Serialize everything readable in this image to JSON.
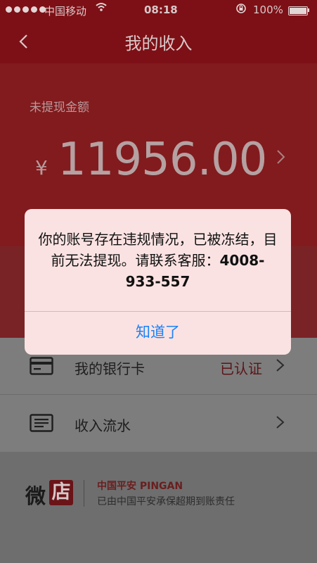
{
  "status_bar": {
    "carrier": "中国移动",
    "time": "08:18",
    "battery": "100%"
  },
  "nav": {
    "title": "我的收入",
    "back_icon": "chevron-left-icon"
  },
  "income": {
    "label": "未提现金额",
    "currency": "¥",
    "amount": "11956.00"
  },
  "list": {
    "items": [
      {
        "label": "我的银行卡",
        "status": "已认证",
        "icon": "bank-card-icon"
      },
      {
        "label": "收入流水",
        "status": "",
        "icon": "document-list-icon"
      }
    ]
  },
  "footer": {
    "logo_wei": "微",
    "logo_dian": "店",
    "brand": "中国平安 PINGAN",
    "note": "已由中国平安承保超期到账责任"
  },
  "dialog": {
    "message": "你的账号存在违规情况，已被冻结，目前无法提现。请联系客服：",
    "phone": "4008-933-557",
    "button": "知道了"
  },
  "colors": {
    "header_red": "#7d1016",
    "link_blue": "#1a82f7"
  }
}
